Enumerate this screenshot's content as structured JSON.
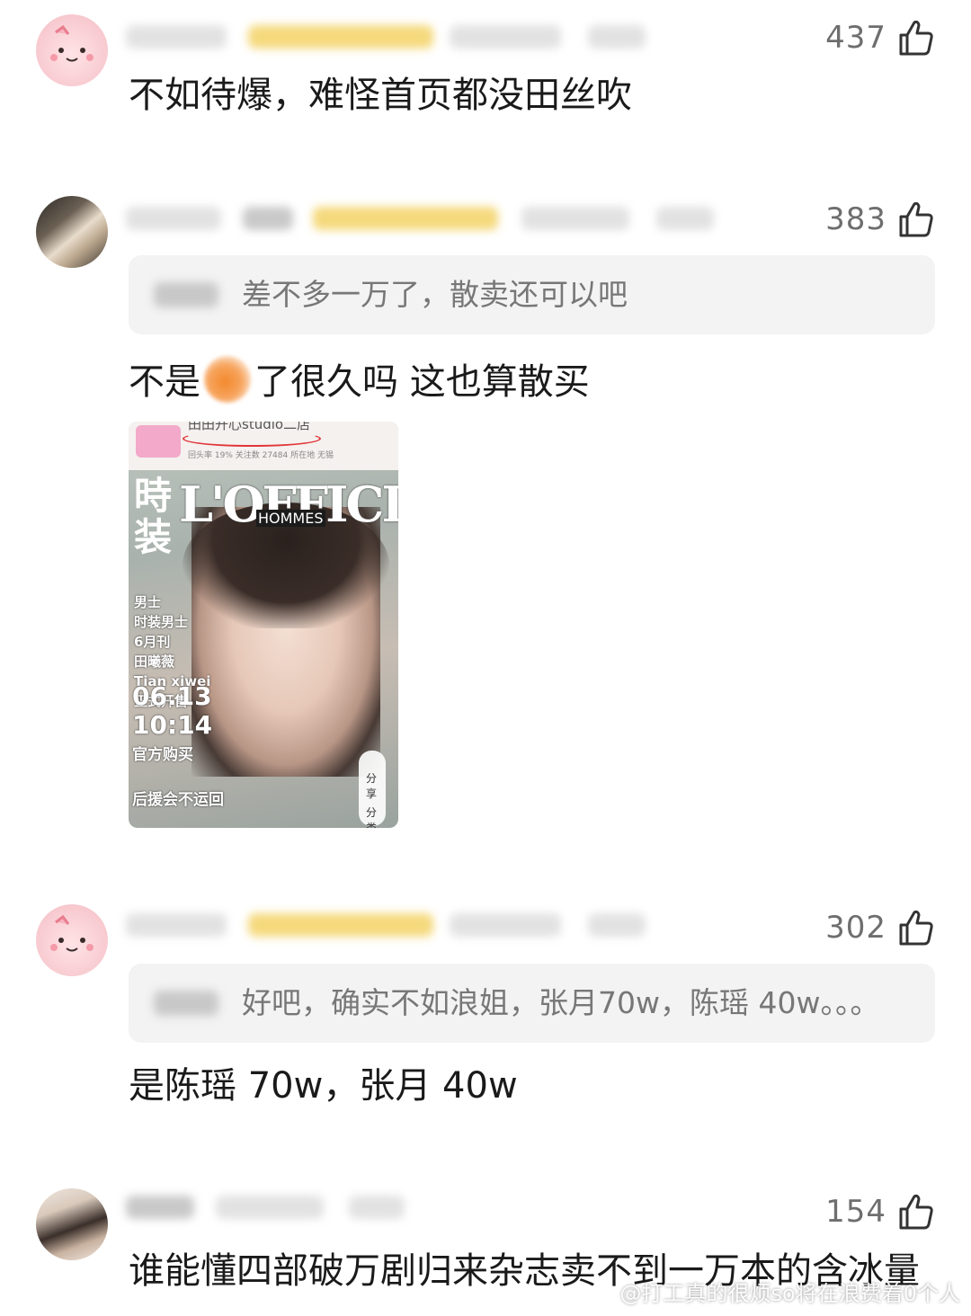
{
  "comments": [
    {
      "likes": "437",
      "text": "不如待爆，难怪首页都没田丝吹"
    },
    {
      "likes": "383",
      "quote": "差不多一万了，散卖还可以吧",
      "text_before": "不是",
      "text_after": "了很久吗 这也算散买",
      "image": {
        "shop": "田田开心studio二店",
        "meta": "回头率 19%   关注数 27484   所在地 无锡",
        "title": "L'OFFICIEL",
        "subtitle": "HOMMES",
        "cn_title": "時装",
        "side_text": "男士\n时装男士\n6月刊\n田曦薇\nTian xiwei\n正式开售",
        "date": "06.13\n10:14",
        "buy": "官方购买",
        "event": "后援会不运回",
        "share": "分享",
        "category": "分类"
      }
    },
    {
      "likes": "302",
      "quote": "好吧，确实不如浪姐，张月70w，陈瑶 40w。。。",
      "text": "是陈瑶 70w，张月 40w"
    },
    {
      "likes": "154",
      "text": "谁能懂四部破万剧归来杂志卖不到一万本的含冰量"
    }
  ],
  "watermark": "@打工真的很烦so将在浪费着0个人"
}
